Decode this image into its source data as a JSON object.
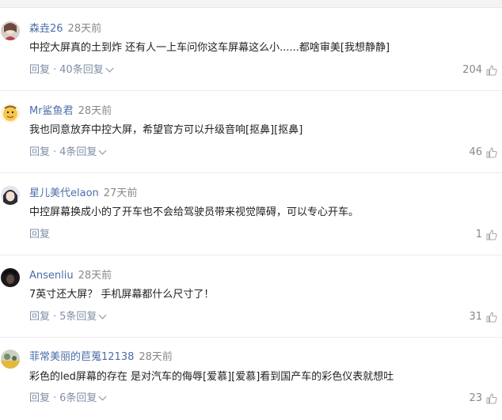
{
  "comments": [
    {
      "user": "森垚26",
      "time": "28天前",
      "text": "中控大屏真的土到炸  还有人一上车问你这车屏幕这么小......都啥审美[我想静静]",
      "reply_label": "回复",
      "replies_label": "40条回复",
      "likes": "204",
      "avatar_icon": "avatar-icon",
      "has_replies": true
    },
    {
      "user": "Mr鲨鱼君",
      "time": "28天前",
      "text": "我也同意放弃中控大屏，希望官方可以升级音响[抠鼻][抠鼻]",
      "reply_label": "回复",
      "replies_label": "4条回复",
      "likes": "46",
      "avatar_icon": "avatar-icon",
      "has_replies": true
    },
    {
      "user": "星儿美代elaon",
      "time": "27天前",
      "text": "中控屏幕换成小的了开车也不会给驾驶员带来视觉障碍，可以专心开车。",
      "reply_label": "回复",
      "replies_label": "",
      "likes": "1",
      "avatar_icon": "avatar-icon",
      "has_replies": false
    },
    {
      "user": "Ansenliu",
      "time": "28天前",
      "text": "7英寸还大屏？ 手机屏幕都什么尺寸了！",
      "reply_label": "回复",
      "replies_label": "5条回复",
      "likes": "31",
      "avatar_icon": "avatar-icon",
      "has_replies": true
    },
    {
      "user": "菲常美丽的苣蒐12138",
      "time": "28天前",
      "text": "彩色的led屏幕的存在 是对汽车的侮辱[爱慕][爱慕]看到国产车的彩色仪表就想吐",
      "reply_label": "回复",
      "replies_label": "6条回复",
      "likes": "23",
      "avatar_icon": "avatar-icon",
      "has_replies": true
    }
  ],
  "separator": "·",
  "colors": {
    "username": "#4a6ea9",
    "action": "#7f8fa6",
    "muted": "#888888"
  }
}
